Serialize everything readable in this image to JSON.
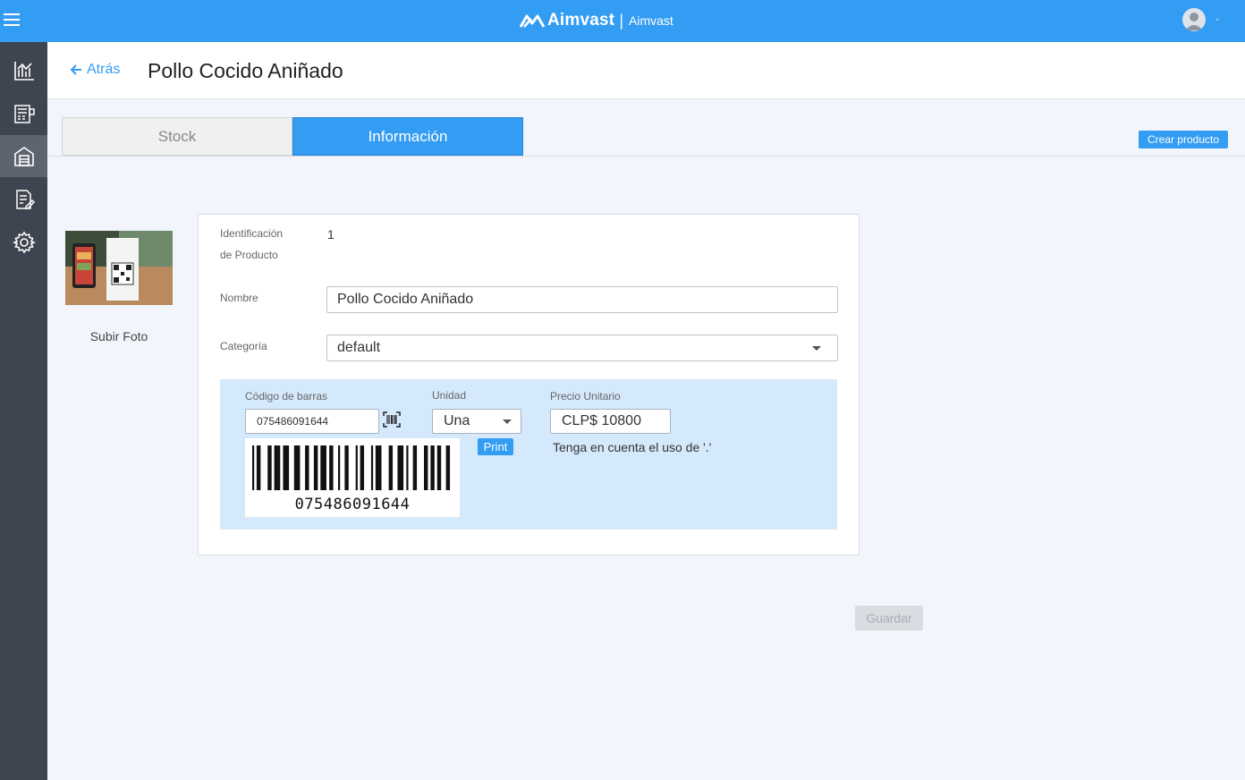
{
  "app": {
    "brand_name": "Aimvast",
    "brand_separator": "|",
    "brand_sub": "Aimvast"
  },
  "sidebar": {
    "items": [
      "analytics-icon",
      "pos-icon",
      "warehouse-icon",
      "document-edit-icon",
      "gear-icon"
    ],
    "active": "warehouse-icon"
  },
  "header": {
    "back_label": "Atrás",
    "title": "Pollo Cocido Aniñado"
  },
  "tabs": [
    {
      "label": "Stock",
      "active": false
    },
    {
      "label": "Información",
      "active": true
    }
  ],
  "actions": {
    "create_label": "Crear producto",
    "save_label": "Guardar"
  },
  "photo": {
    "upload_label": "Subir Foto"
  },
  "form": {
    "id_label_line1": "Identificación",
    "id_label_line2": "de Producto",
    "id_value": "1",
    "name_label": "Nombre",
    "name_value": "Pollo Cocido Aniñado",
    "category_label": "Categoría",
    "category_value": "default",
    "barcode_label": "Código de barras",
    "barcode_value": "075486091644",
    "unit_label": "Unidad",
    "unit_value": "Una",
    "price_label": "Precio Unitario",
    "price_value": "CLP$ 10800",
    "print_label": "Print",
    "note": "Tenga en cuenta el uso de '.'"
  },
  "colors": {
    "accent": "#339cf3",
    "sidebar": "#3f4550",
    "panel": "#d5e9fc"
  }
}
